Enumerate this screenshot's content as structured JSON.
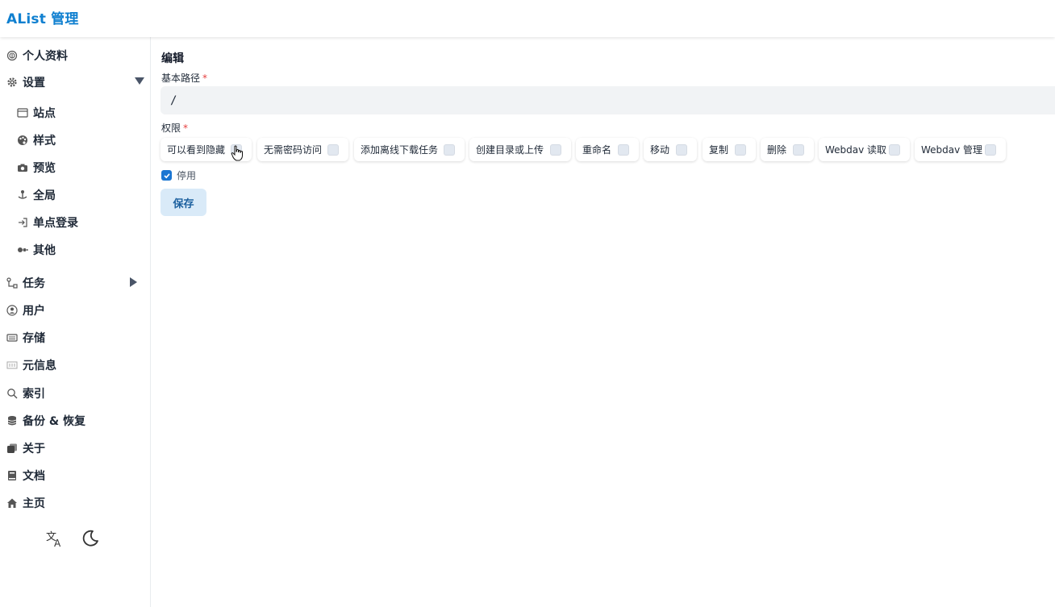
{
  "header": {
    "title": "AList 管理"
  },
  "sidebar": {
    "items": [
      {
        "label": "个人资料",
        "icon": "fingerprint-icon"
      },
      {
        "label": "设置",
        "icon": "gear-icon",
        "expanded": true
      },
      {
        "label": "站点",
        "icon": "window-icon"
      },
      {
        "label": "样式",
        "icon": "palette-icon"
      },
      {
        "label": "预览",
        "icon": "camera-icon"
      },
      {
        "label": "全局",
        "icon": "joystick-icon"
      },
      {
        "label": "单点登录",
        "icon": "login-icon"
      },
      {
        "label": "其他",
        "icon": "dots-icon"
      },
      {
        "label": "任务",
        "icon": "tasks-icon",
        "expanded": false
      },
      {
        "label": "用户",
        "icon": "user-circle-icon"
      },
      {
        "label": "存储",
        "icon": "storage-icon"
      },
      {
        "label": "元信息",
        "icon": "metadata-icon"
      },
      {
        "label": "索引",
        "icon": "search-icon"
      },
      {
        "label": "备份 & 恢复",
        "icon": "database-icon"
      },
      {
        "label": "关于",
        "icon": "copy-icon"
      },
      {
        "label": "文档",
        "icon": "book-icon"
      },
      {
        "label": "主页",
        "icon": "home-icon"
      }
    ]
  },
  "main": {
    "title": "编辑",
    "base_path": {
      "label": "基本路径",
      "required_mark": "*",
      "value": "/"
    },
    "permissions": {
      "label": "权限",
      "required_mark": "*",
      "items": [
        {
          "label": "可以看到隐藏",
          "checked": false
        },
        {
          "label": "无需密码访问",
          "checked": false
        },
        {
          "label": "添加离线下载任务",
          "checked": false
        },
        {
          "label": "创建目录或上传",
          "checked": false
        },
        {
          "label": "重命名",
          "checked": false
        },
        {
          "label": "移动",
          "checked": false
        },
        {
          "label": "复制",
          "checked": false
        },
        {
          "label": "删除",
          "checked": false
        },
        {
          "label": "Webdav 读取",
          "checked": false
        },
        {
          "label": "Webdav 管理",
          "checked": false
        }
      ]
    },
    "disabled": {
      "label": "停用",
      "checked": true
    },
    "save_label": "保存"
  },
  "colors": {
    "brand": "#1080d0",
    "accent": "#1b76d2",
    "button_bg": "#d9eaf8",
    "required": "#e53e3e"
  }
}
